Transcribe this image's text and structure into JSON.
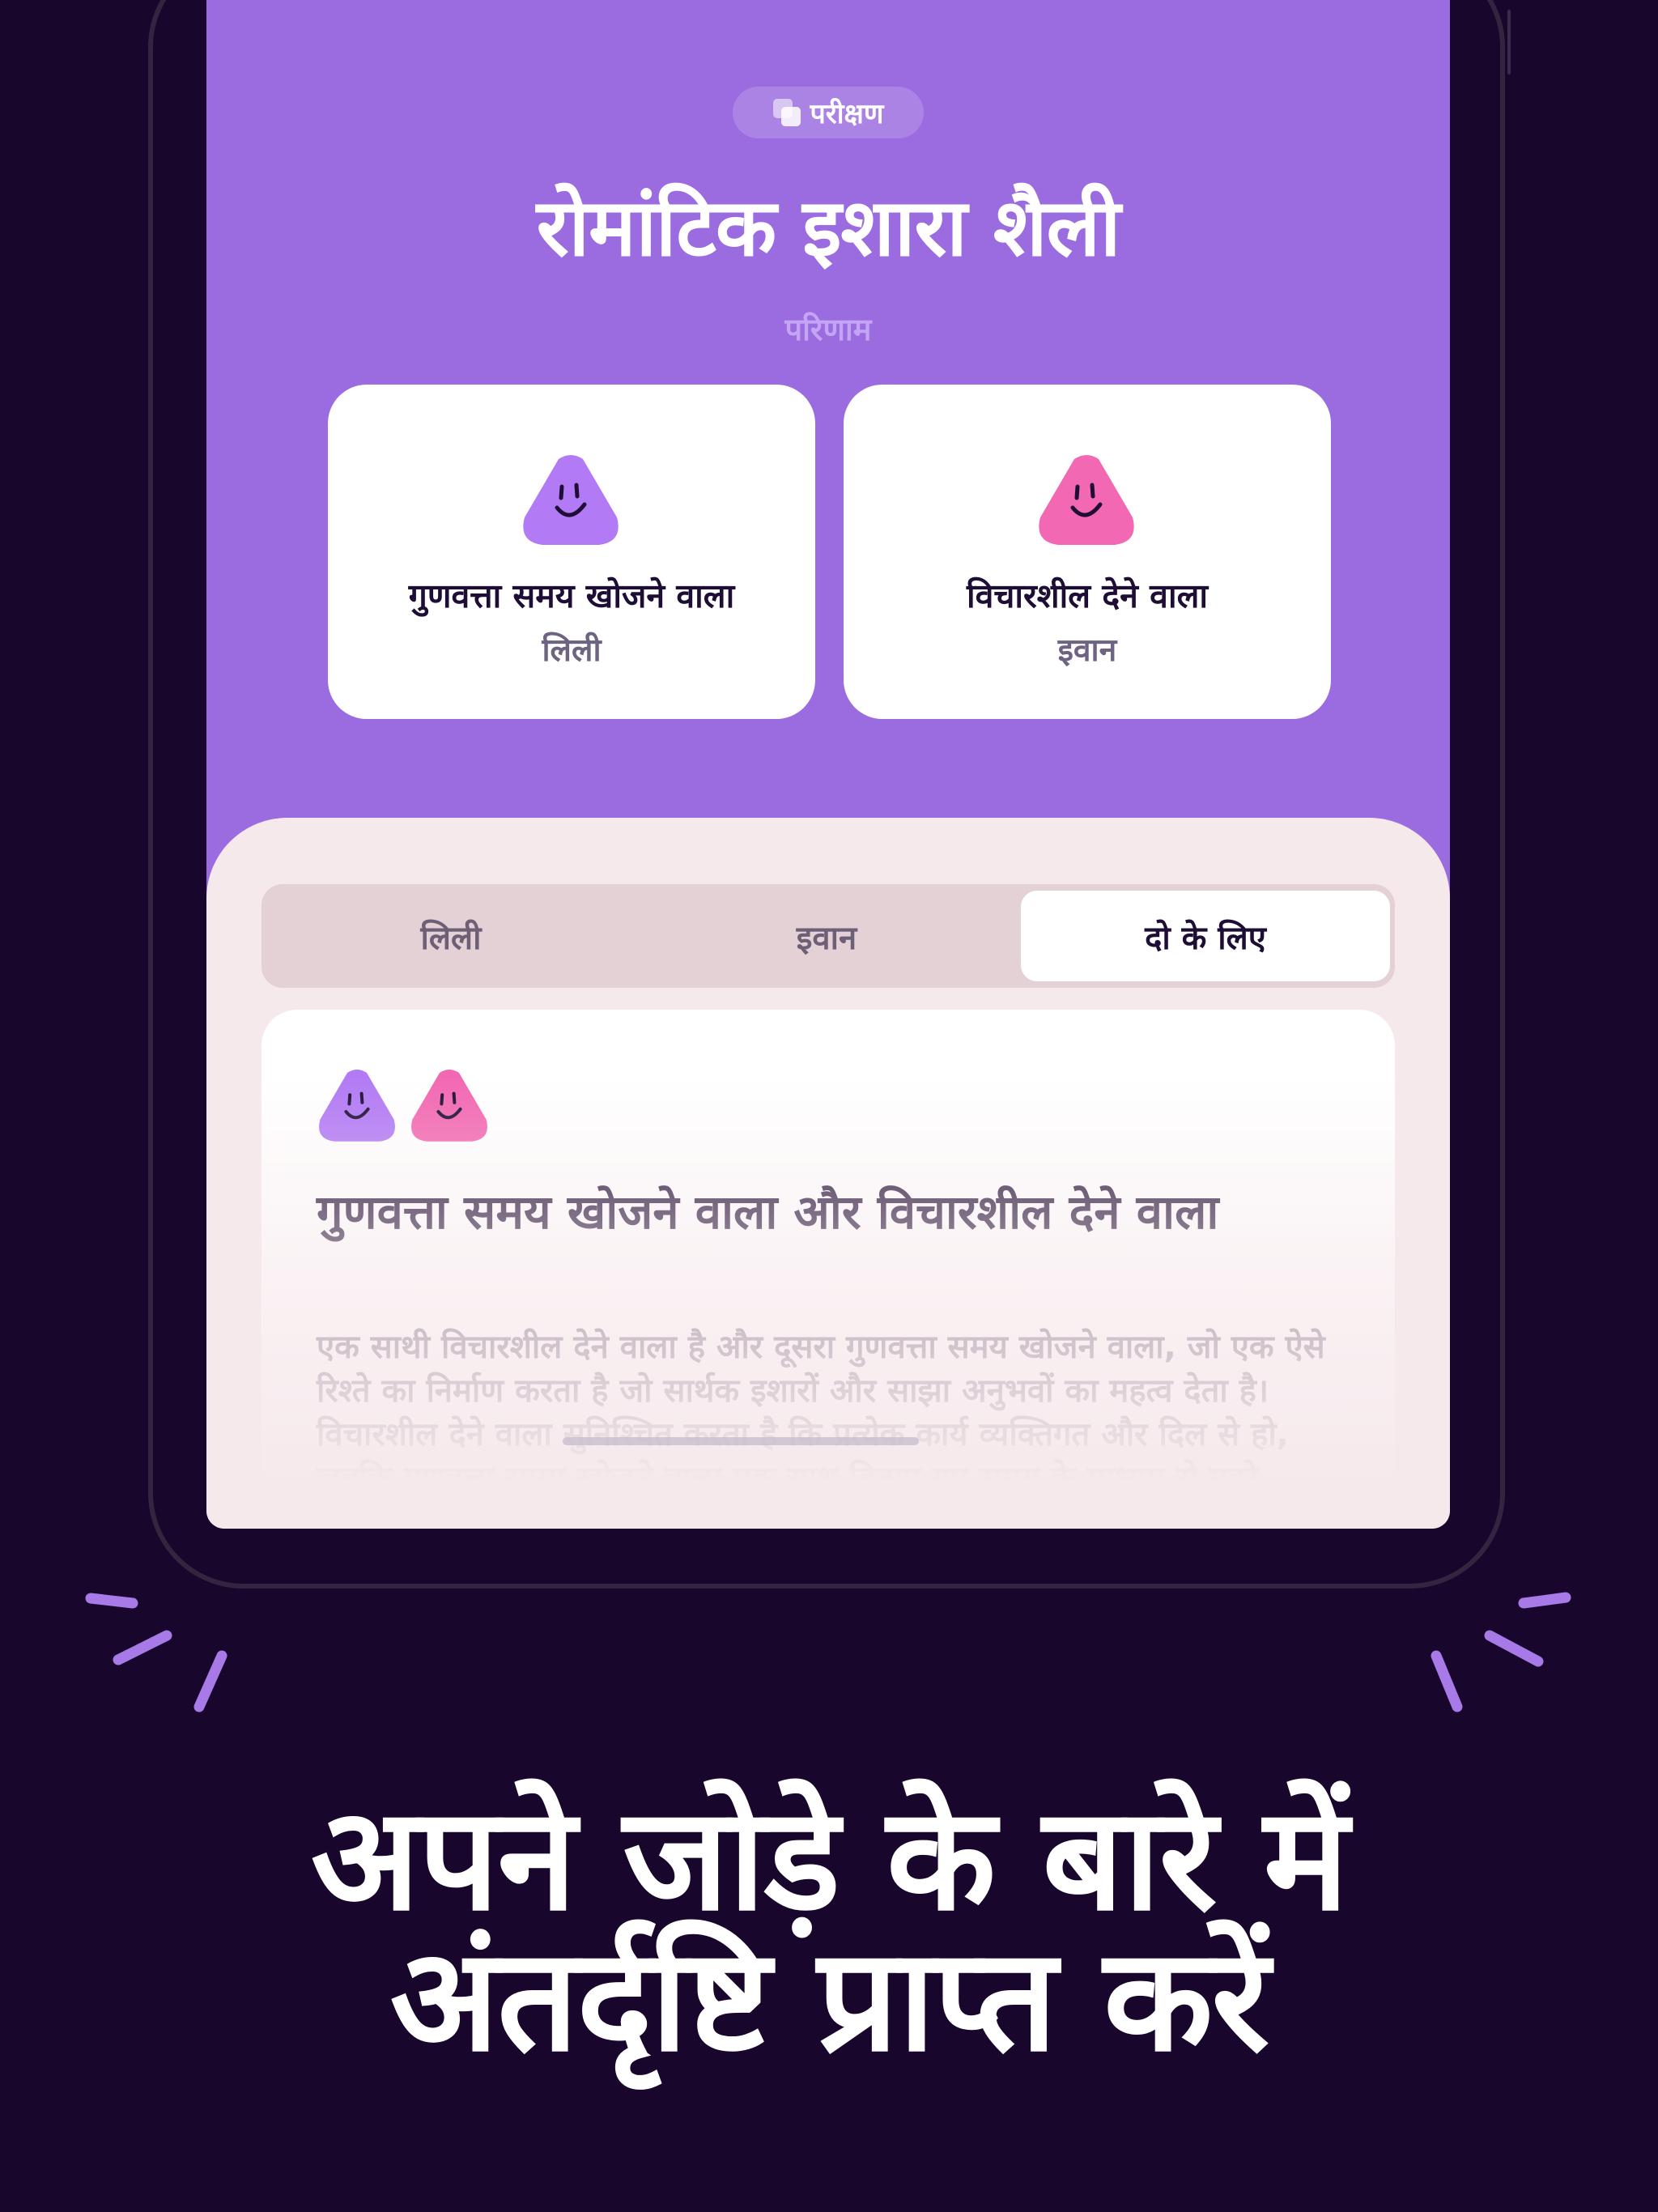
{
  "badge": {
    "label": "परीक्षण",
    "icon": "stack-squares-icon"
  },
  "quiz": {
    "title": "रोमांटिक इशारा शैली",
    "results_label": "परिणाम"
  },
  "partners": [
    {
      "type": "गुणवत्ता समय खोजने वाला",
      "name": "लिली",
      "color": "#b27af5",
      "icon": "smiley-blob-icon"
    },
    {
      "type": "विचारशील देने वाला",
      "name": "इवान",
      "color": "#f268b2",
      "icon": "smiley-blob-icon"
    }
  ],
  "tabs": [
    {
      "label": "लिली",
      "selected": false
    },
    {
      "label": "इवान",
      "selected": false
    },
    {
      "label": "दो के लिए",
      "selected": true
    }
  ],
  "result_card": {
    "title": "गुणवत्ता समय खोजने वाला और विचारशील देने वाला",
    "body": "एक साथी विचारशील देने वाला है और दूसरा गुणवत्ता समय खोजने वाला, जो एक ऐसे रिश्ते का निर्माण करता है जो सार्थक इशारों और साझा अनुभवों का महत्व देता है। विचारशील देने वाला सुनिश्चित करता है कि प्रत्येक कार्य व्यक्तिगत और दिल से हो, जबकि गुणवत्ता समय खोजने वाला एक साथ बिताए गए समय के माध्यम से गहरे भावनात्मक संबंधों को"
  },
  "headline": {
    "line1": "अपने जोड़े के बारे में",
    "line2": "अंतर्दृष्टि प्राप्त करें"
  },
  "colors": {
    "background": "#18062c",
    "screen_purple": "#9b6ce0",
    "sheet": "#f6e9ec",
    "accent_spark": "#a77ae8"
  }
}
